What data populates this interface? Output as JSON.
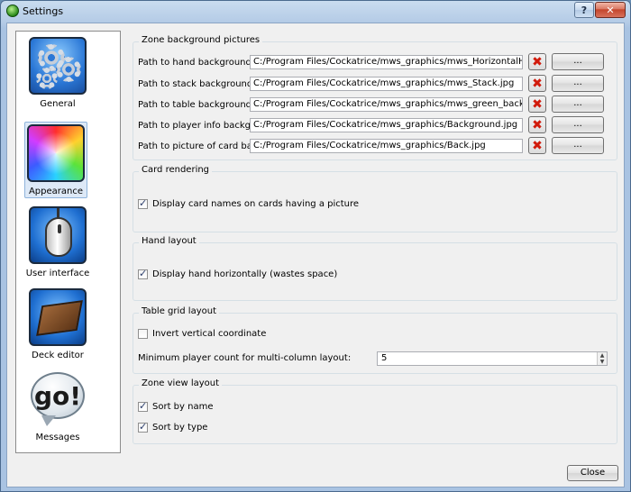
{
  "window": {
    "title": "Settings",
    "help_label": "?",
    "close_label": "✕"
  },
  "sidebar": {
    "items": [
      {
        "label": "General",
        "icon": "gears-icon"
      },
      {
        "label": "Appearance",
        "icon": "color-wheel-icon",
        "selected": true
      },
      {
        "label": "User interface",
        "icon": "mouse-icon"
      },
      {
        "label": "Deck editor",
        "icon": "book-icon"
      },
      {
        "label": "Messages",
        "icon": "speech-bubble-icon",
        "icon_text": "go!"
      }
    ]
  },
  "zone_backgrounds": {
    "title": "Zone background pictures",
    "clear_icon": "✖",
    "browse_label": "...",
    "rows": [
      {
        "label": "Path to hand background:",
        "value": "C:/Program Files/Cockatrice/mws_graphics/mws_HorizontalHand_Hand.jpg"
      },
      {
        "label": "Path to stack background:",
        "value": "C:/Program Files/Cockatrice/mws_graphics/mws_Stack.jpg"
      },
      {
        "label": "Path to table background:",
        "value": "C:/Program Files/Cockatrice/mws_graphics/mws_green_background.png"
      },
      {
        "label": "Path to player info background:",
        "value": "C:/Program Files/Cockatrice/mws_graphics/Background.jpg"
      },
      {
        "label": "Path to picture of card back:",
        "value": "C:/Program Files/Cockatrice/mws_graphics/Back.jpg"
      }
    ]
  },
  "card_rendering": {
    "title": "Card rendering",
    "display_names_label": "Display card names on cards having a picture",
    "display_names_checked": true
  },
  "hand_layout": {
    "title": "Hand layout",
    "horizontal_label": "Display hand horizontally (wastes space)",
    "horizontal_checked": true
  },
  "table_grid": {
    "title": "Table grid layout",
    "invert_label": "Invert vertical coordinate",
    "invert_checked": false,
    "min_players_label": "Minimum player count for multi-column layout:",
    "min_players_value": "5"
  },
  "zone_view": {
    "title": "Zone view layout",
    "sort_name_label": "Sort by name",
    "sort_name_checked": true,
    "sort_type_label": "Sort by type",
    "sort_type_checked": true
  },
  "footer": {
    "close_label": "Close"
  },
  "colors": {
    "title_bar": "#b4cbe6",
    "client_bg": "#f0f0f0",
    "selected_item": "#dde9f7",
    "clear_x": "#d11a0b"
  }
}
